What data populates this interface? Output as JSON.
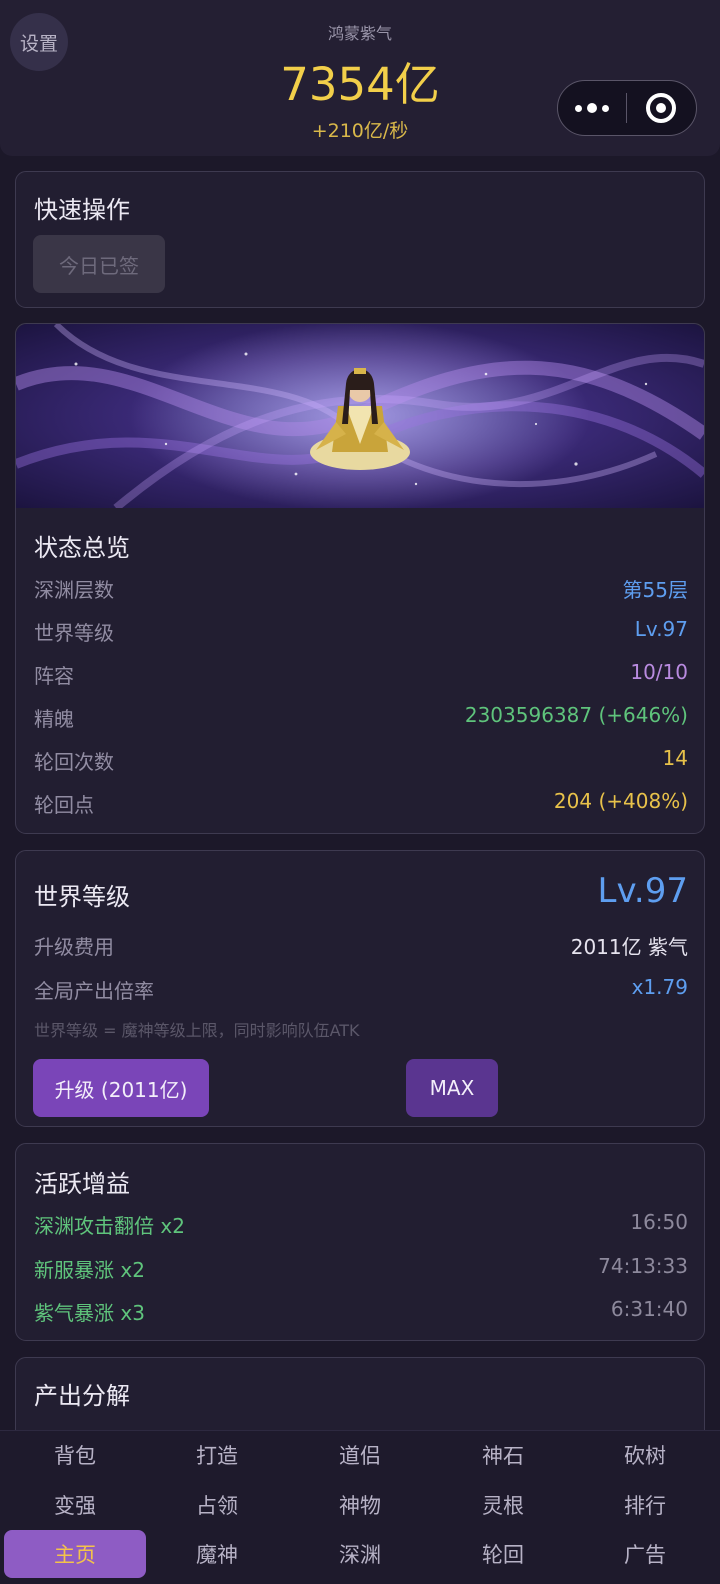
{
  "header": {
    "settings_label": "设置",
    "currency_name": "鸿蒙紫气",
    "currency_amount": "7354亿",
    "currency_rate": "+210亿/秒"
  },
  "quick_actions": {
    "title": "快速操作",
    "signed_label": "今日已签"
  },
  "status": {
    "title": "状态总览",
    "rows": [
      {
        "label": "深渊层数",
        "value": "第55层",
        "color": "#5e9ef0"
      },
      {
        "label": "世界等级",
        "value": "Lv.97",
        "color": "#5e9ef0"
      },
      {
        "label": "阵容",
        "value": "10/10",
        "color": "#b98be0"
      },
      {
        "label": "精魄",
        "value": "2303596387 (+646%)",
        "color": "#5fc47c"
      },
      {
        "label": "轮回次数",
        "value": "14",
        "color": "#e8c24a"
      },
      {
        "label": "轮回点",
        "value": "204 (+408%)",
        "color": "#e8c24a"
      }
    ]
  },
  "world_level": {
    "title": "世界等级",
    "level": "Lv.97",
    "cost_label": "升级费用",
    "cost_value": "2011亿 紫气",
    "mult_label": "全局产出倍率",
    "mult_value": "x1.79",
    "hint": "世界等级 = 魔神等级上限，同时影响队伍ATK",
    "upgrade_label": "升级 (2011亿)",
    "max_label": "MAX"
  },
  "buffs": {
    "title": "活跃增益",
    "items": [
      {
        "name": "深渊攻击翻倍 x2",
        "time": "16:50"
      },
      {
        "name": "新服暴涨 x2",
        "time": "74:13:33"
      },
      {
        "name": "紫气暴涨 x3",
        "time": "6:31:40"
      }
    ]
  },
  "output": {
    "title": "产出分解"
  },
  "nav": {
    "rows": [
      [
        "背包",
        "打造",
        "道侣",
        "神石",
        "砍树"
      ],
      [
        "变强",
        "占领",
        "神物",
        "灵根",
        "排行"
      ],
      [
        "主页",
        "魔神",
        "深渊",
        "轮回",
        "广告"
      ]
    ],
    "active": "主页"
  },
  "colors": {
    "accent": "#7a45b8",
    "gold": "#f2cf4a",
    "blue": "#5e9ef0",
    "green": "#5fc47c"
  }
}
